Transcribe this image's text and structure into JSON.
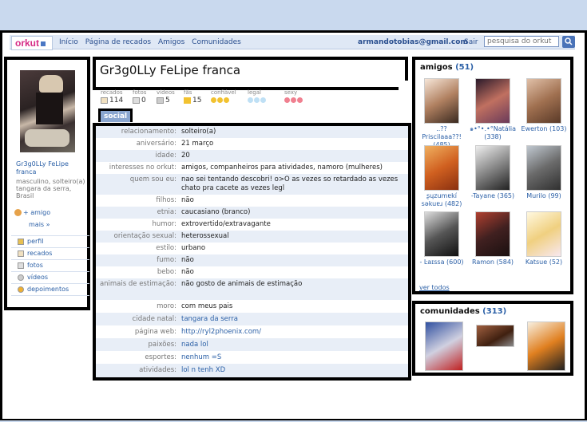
{
  "header": {
    "logo": "orkut",
    "nav": [
      "Início",
      "Página de recados",
      "Amigos",
      "Comunidades"
    ],
    "email": "armandotobias@gmail.com",
    "logout": "Sair",
    "search_placeholder": "pesquisa do orkut"
  },
  "profile": {
    "name": "Gr3g0LLy FeLipe franca",
    "name_short": "Gr3g0LLy FeLipe franca",
    "summary": "masculino, solteiro(a) tangara da serra, Brasil",
    "add_friend": "+ amigo",
    "more": "mais »"
  },
  "sidebar": {
    "items": [
      {
        "label": "perfil",
        "icon": "profile-icon"
      },
      {
        "label": "recados",
        "icon": "scrap-icon"
      },
      {
        "label": "fotos",
        "icon": "photo-icon"
      },
      {
        "label": "vídeos",
        "icon": "video-icon"
      },
      {
        "label": "depoimentos",
        "icon": "testimonial-icon"
      }
    ]
  },
  "stats": [
    {
      "label": "recados",
      "value": "114",
      "icon": "scrap-icon"
    },
    {
      "label": "fotos",
      "value": "0",
      "icon": "photo-icon"
    },
    {
      "label": "vídeos",
      "value": "5",
      "icon": "video-icon"
    },
    {
      "label": "fãs",
      "value": "15",
      "icon": "star-icon"
    },
    {
      "label": "confiável",
      "value": "",
      "icon": "smiley-icon"
    },
    {
      "label": "legal",
      "value": "",
      "icon": "ice-icon"
    },
    {
      "label": "sexy",
      "value": "",
      "icon": "heart-icon"
    }
  ],
  "tab": "social",
  "details": [
    {
      "k": "relacionamento:",
      "v": "solteiro(a)"
    },
    {
      "k": "aniversário:",
      "v": "21 março"
    },
    {
      "k": "idade:",
      "v": "20"
    },
    {
      "k": "interesses no orkut:",
      "v": "amigos, companheiros para atividades, namoro (mulheres)"
    },
    {
      "k": "quem sou eu:",
      "v": "nao sei tentando descobri! o>O as vezes so retardado as vezes chato pra cacete as vezes legl"
    },
    {
      "k": "filhos:",
      "v": "não"
    },
    {
      "k": "etnia:",
      "v": "caucasiano (branco)"
    },
    {
      "k": "humor:",
      "v": "extrovertido/extravagante"
    },
    {
      "k": "orientação sexual:",
      "v": "heterossexual"
    },
    {
      "k": "estilo:",
      "v": "urbano"
    },
    {
      "k": "fumo:",
      "v": "não"
    },
    {
      "k": "bebo:",
      "v": "não"
    },
    {
      "k": "animais de estimação:",
      "v": "não gosto de animais de estimação"
    },
    {
      "k": "moro:",
      "v": "com meus pais"
    },
    {
      "k": "cidade natal:",
      "v": "tangara da serra"
    },
    {
      "k": "página web:",
      "v": "http://ryl2phoenix.com/"
    },
    {
      "k": "paixões:",
      "v": "nada lol"
    },
    {
      "k": "esportes:",
      "v": "nenhum =S"
    },
    {
      "k": "atividades:",
      "v": "lol n tenh XD"
    }
  ],
  "amigos": {
    "title": "amigos",
    "count": "(51)",
    "see_all": "ver todos",
    "friends": [
      {
        "name": "..??Priscilaaa??! (485)"
      },
      {
        "name": "๑•°•.•°Natália (338)"
      },
      {
        "name": "Ewerton (103)"
      },
      {
        "name": "ʂɥzumɐkí sǝkuɐɹ (482)"
      },
      {
        "name": "-Tayane (365)"
      },
      {
        "name": "Murilo (99)"
      },
      {
        "name": "- Ŀaɪssa (600)"
      },
      {
        "name": "Ramon (584)"
      },
      {
        "name": "Katsue (52)"
      }
    ]
  },
  "comunidades": {
    "title": "comunidades",
    "count": "(313)"
  }
}
